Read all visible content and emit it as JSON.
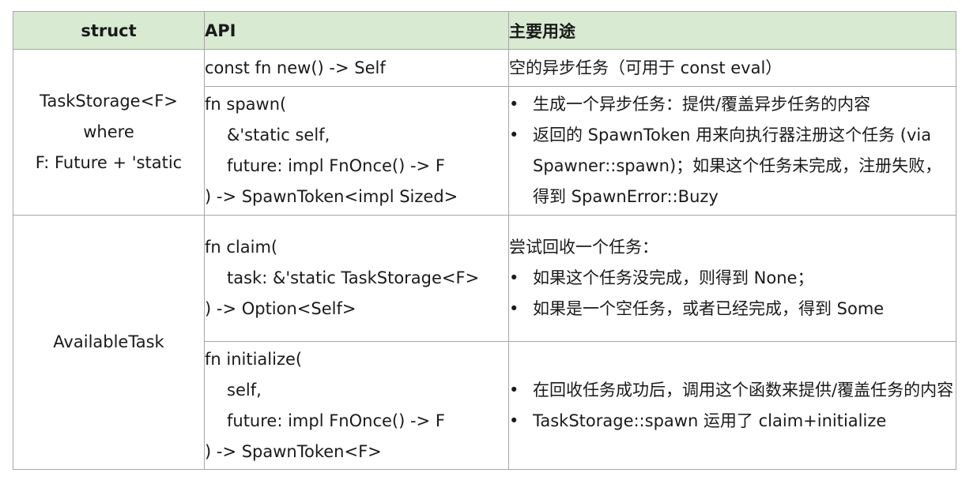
{
  "header": {
    "struct": "struct",
    "api": "API",
    "usage": "主要用途"
  },
  "task_storage": {
    "name_lines": [
      "TaskStorage<F>",
      "where",
      "F: Future + 'static"
    ],
    "new": {
      "signature": "const fn new() -> Self",
      "usage": "空的异步任务（可用于 const eval）"
    },
    "spawn": {
      "signature_lines": [
        "fn spawn(",
        "&'static self,",
        "future: impl FnOnce() -> F",
        ") -> SpawnToken<impl Sized>"
      ],
      "usage_bullets": [
        "生成一个异步任务：提供/覆盖异步任务的内容",
        "返回的 SpawnToken 用来向执行器注册这个任务 (via Spawner::spawn)；如果这个任务未完成，注册失败，得到 SpawnError::Buzy"
      ]
    }
  },
  "available_task": {
    "name": "AvailableTask",
    "claim": {
      "signature_lines": [
        "fn claim(",
        "task: &'static TaskStorage<F>",
        ") -> Option<Self>"
      ],
      "usage_intro": "尝试回收一个任务：",
      "usage_bullets": [
        "如果这个任务没完成，则得到 None；",
        "如果是一个空任务，或者已经完成，得到 Some"
      ]
    },
    "initialize": {
      "signature_lines": [
        "fn initialize(",
        "self,",
        "future: impl FnOnce() -> F",
        ") -> SpawnToken<F>"
      ],
      "usage_bullets": [
        "在回收任务成功后，调用这个函数来提供/覆盖任务的内容",
        "TaskStorage::spawn 运用了 claim+initialize"
      ]
    }
  }
}
